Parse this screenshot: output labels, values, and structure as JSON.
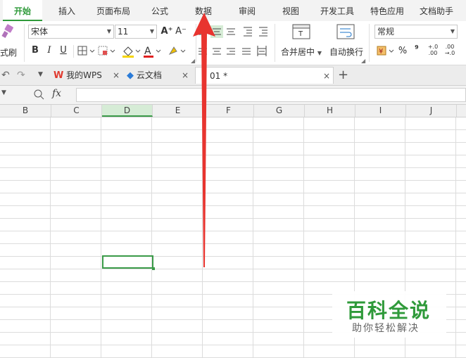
{
  "ribbon_tabs": [
    "开始",
    "插入",
    "页面布局",
    "公式",
    "数据",
    "审阅",
    "视图",
    "开发工具",
    "特色应用",
    "文档助手"
  ],
  "clipboard": {
    "format_painter_label": "式刷"
  },
  "font": {
    "name": "宋体",
    "size": "11",
    "grow_label": "A⁺",
    "shrink_label": "A⁻",
    "bold": "B",
    "italic": "I",
    "underline": "U"
  },
  "alignment": {
    "merge_center_label": "合并居中",
    "wrap_text_label": "自动换行"
  },
  "number": {
    "format_value": "常规",
    "percent": "%",
    "comma": "⁹",
    "inc_decimal": "+.0 .00",
    "dec_decimal": ".00 →.0"
  },
  "doc_tabs": [
    {
      "label": "我的WPS"
    },
    {
      "label": "云文档"
    },
    {
      "label": "01 *"
    }
  ],
  "formula_bar": {
    "fx_label": "fx",
    "value": ""
  },
  "columns": [
    "B",
    "C",
    "D",
    "E",
    "F",
    "G",
    "H",
    "I",
    "J"
  ],
  "selected_column": "D",
  "watermark": {
    "title": "百科全说",
    "subtitle": "助你轻松解决"
  },
  "colors": {
    "accent": "#2f9a3a",
    "arrow": "#e8342f",
    "font_color_bar": "#e02020",
    "fill_color_bar": "#f5d400"
  }
}
